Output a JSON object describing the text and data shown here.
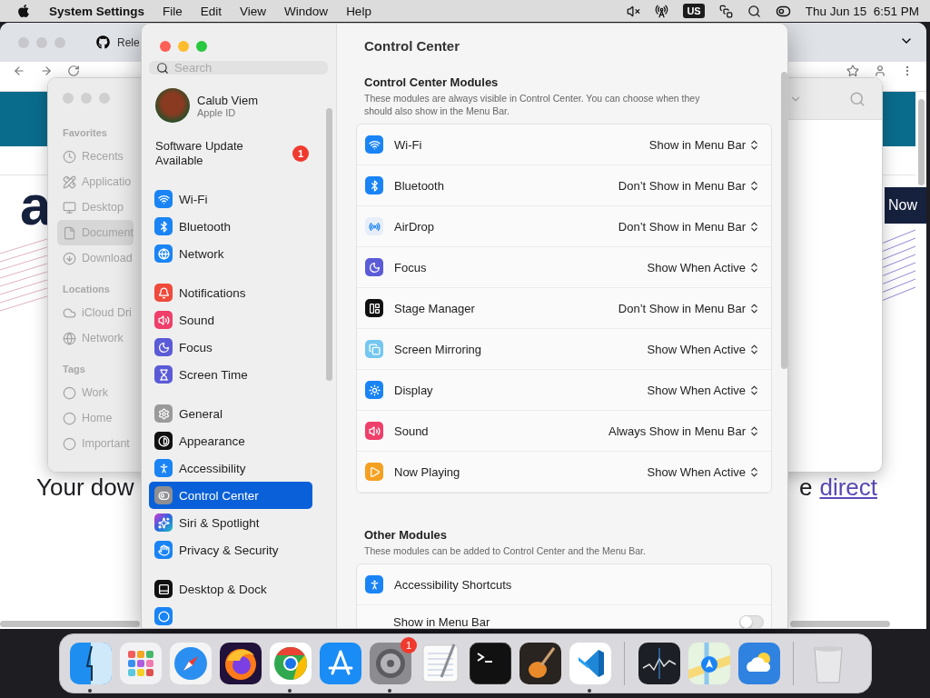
{
  "menu_bar": {
    "app": "System Settings",
    "menus": [
      "File",
      "Edit",
      "View",
      "Window",
      "Help"
    ],
    "input_source": "US",
    "clock": "Thu Jun 15  6:51 PM"
  },
  "browser": {
    "tab_title": "Rele",
    "heading_fragment": "a",
    "button_fragment": "Now",
    "text_left": "Your dow",
    "text_right": "e",
    "link": "direct"
  },
  "finder": {
    "sections": [
      {
        "title": "Favorites",
        "items": [
          {
            "label": "Recents",
            "kind": "recents",
            "selected": false
          },
          {
            "label": "Applicatio",
            "kind": "applications",
            "selected": false
          },
          {
            "label": "Desktop",
            "kind": "desktop",
            "selected": false
          },
          {
            "label": "Document",
            "kind": "documents",
            "selected": true
          },
          {
            "label": "Download",
            "kind": "downloads",
            "selected": false
          }
        ]
      },
      {
        "title": "Locations",
        "items": [
          {
            "label": "iCloud Dri",
            "kind": "icloud",
            "selected": false
          },
          {
            "label": "Network",
            "kind": "network",
            "selected": false
          }
        ]
      },
      {
        "title": "Tags",
        "items": [
          {
            "label": "Work",
            "kind": "tag",
            "selected": false
          },
          {
            "label": "Home",
            "kind": "tag",
            "selected": false
          },
          {
            "label": "Important",
            "kind": "tag",
            "selected": false
          }
        ]
      }
    ]
  },
  "settings": {
    "search": {
      "placeholder": "Search"
    },
    "account": {
      "name": "Calub Viem",
      "subtitle": "Apple ID"
    },
    "update": {
      "label": "Software Update Available",
      "badge": "1"
    },
    "sidebar_groups": [
      [
        {
          "label": "Wi-Fi",
          "kind": "wifi",
          "selected": false
        },
        {
          "label": "Bluetooth",
          "kind": "bluetooth",
          "selected": false
        },
        {
          "label": "Network",
          "kind": "network",
          "selected": false
        }
      ],
      [
        {
          "label": "Notifications",
          "kind": "notifications",
          "selected": false
        },
        {
          "label": "Sound",
          "kind": "sound",
          "selected": false
        },
        {
          "label": "Focus",
          "kind": "focus",
          "selected": false
        },
        {
          "label": "Screen Time",
          "kind": "screentime",
          "selected": false
        }
      ],
      [
        {
          "label": "General",
          "kind": "general",
          "selected": false
        },
        {
          "label": "Appearance",
          "kind": "appearance",
          "selected": false
        },
        {
          "label": "Accessibility",
          "kind": "accessibility",
          "selected": false
        },
        {
          "label": "Control Center",
          "kind": "controlcenter",
          "selected": true
        },
        {
          "label": "Siri & Spotlight",
          "kind": "siri",
          "selected": false
        },
        {
          "label": "Privacy & Security",
          "kind": "privacy",
          "selected": false
        }
      ],
      [
        {
          "label": "Desktop & Dock",
          "kind": "dock",
          "selected": false
        },
        {
          "kind": "partial",
          "selected": false
        }
      ]
    ],
    "title": "Control Center",
    "modules": {
      "title": "Control Center Modules",
      "description": "These modules are always visible in Control Center. You can choose when they should also show in the Menu Bar.",
      "rows": [
        {
          "name": "Wi-Fi",
          "kind": "wifi",
          "value": "Show in Menu Bar"
        },
        {
          "name": "Bluetooth",
          "kind": "bluetooth",
          "value": "Don’t Show in Menu Bar"
        },
        {
          "name": "AirDrop",
          "kind": "airdrop",
          "value": "Don’t Show in Menu Bar"
        },
        {
          "name": "Focus",
          "kind": "focus",
          "value": "Show When Active"
        },
        {
          "name": "Stage Manager",
          "kind": "stage",
          "value": "Don’t Show in Menu Bar"
        },
        {
          "name": "Screen Mirroring",
          "kind": "mirroring",
          "value": "Show When Active"
        },
        {
          "name": "Display",
          "kind": "display",
          "value": "Show When Active"
        },
        {
          "name": "Sound",
          "kind": "sound",
          "value": "Always Show in Menu Bar"
        },
        {
          "name": "Now Playing",
          "kind": "nowplaying",
          "value": "Show When Active"
        }
      ]
    },
    "other": {
      "title": "Other Modules",
      "description": "These modules can be added to Control Center and the Menu Bar.",
      "module": {
        "name": "Accessibility Shortcuts",
        "kind": "accessibility"
      },
      "toggle": {
        "label": "Show in Menu Bar",
        "on": false
      }
    }
  },
  "dock": {
    "groups": [
      [
        {
          "kind": "finder",
          "running": true
        },
        {
          "kind": "launchpad",
          "running": false
        },
        {
          "kind": "safari",
          "running": false
        },
        {
          "kind": "firefox",
          "running": false
        },
        {
          "kind": "chrome",
          "running": true
        },
        {
          "kind": "appstore",
          "running": false
        },
        {
          "kind": "settings",
          "running": true,
          "badge": "1"
        },
        {
          "kind": "textedit",
          "running": false
        },
        {
          "kind": "terminal",
          "running": false
        },
        {
          "kind": "garageband",
          "running": false
        },
        {
          "kind": "vscode",
          "running": true
        }
      ],
      [
        {
          "kind": "stocks",
          "running": false
        },
        {
          "kind": "maps",
          "running": false
        },
        {
          "kind": "weather",
          "running": false
        }
      ],
      [
        {
          "kind": "trash",
          "running": false
        }
      ]
    ]
  }
}
